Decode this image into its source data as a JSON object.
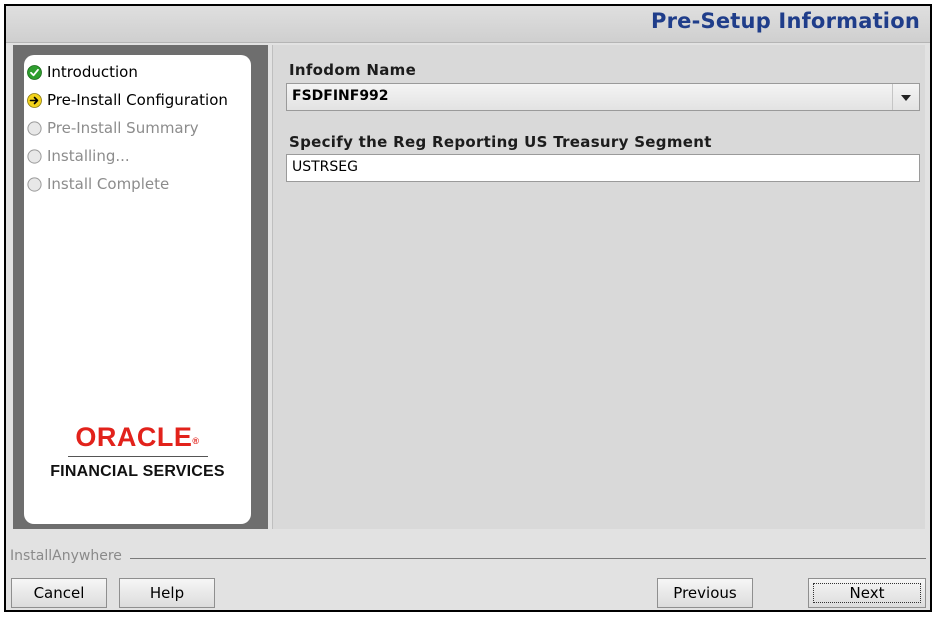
{
  "header": {
    "title": "Pre-Setup Information"
  },
  "steps": [
    {
      "label": "Introduction",
      "state": "done"
    },
    {
      "label": "Pre-Install Configuration",
      "state": "current"
    },
    {
      "label": "Pre-Install Summary",
      "state": "pending"
    },
    {
      "label": "Installing...",
      "state": "pending"
    },
    {
      "label": "Install Complete",
      "state": "pending"
    }
  ],
  "branding": {
    "logo": "ORACLE",
    "tagline": "FINANCIAL SERVICES"
  },
  "form": {
    "infodom_label": "Infodom Name",
    "infodom_value": "FSDFINF992",
    "segment_label": "Specify the Reg Reporting US Treasury Segment",
    "segment_value": "USTRSEG"
  },
  "footer": {
    "vendor": "InstallAnywhere",
    "cancel": "Cancel",
    "help": "Help",
    "previous": "Previous",
    "next": "Next"
  },
  "colors": {
    "title": "#1f3d8a",
    "oracle_red": "#e2221b",
    "done_green": "#2e9e2e",
    "current_yellow": "#f2d21b"
  },
  "icons": {
    "done": "check-circle-icon",
    "current": "arrow-circle-icon",
    "pending": "empty-circle-icon",
    "dropdown": "caret-down-icon"
  }
}
